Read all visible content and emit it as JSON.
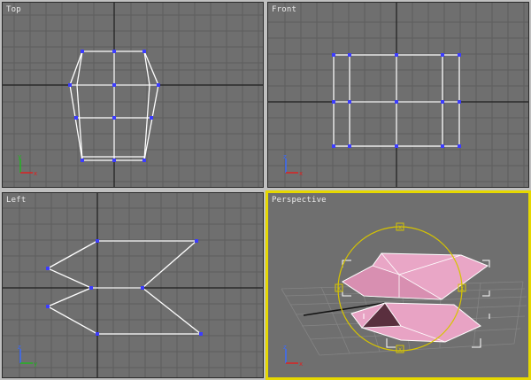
{
  "viewports": {
    "top": {
      "label": "Top"
    },
    "front": {
      "label": "Front"
    },
    "left": {
      "label": "Left"
    },
    "perspective": {
      "label": "Perspective"
    }
  },
  "axis_labels": {
    "x": "x",
    "y": "y",
    "z": "z"
  },
  "gizmo": {
    "handle_label": "X"
  },
  "colors": {
    "viewport_bg": "#6f6f6f",
    "grid_line": "#5e5e5e",
    "home_grid_line": "#1e1e1e",
    "wire": "#ffffff",
    "vertex": "#3c3cff",
    "active_border": "#e6d800",
    "mesh_fill": "#e9a6c6"
  },
  "icons": [
    "axis-tripod-icon",
    "transform-gizmo-icon"
  ]
}
